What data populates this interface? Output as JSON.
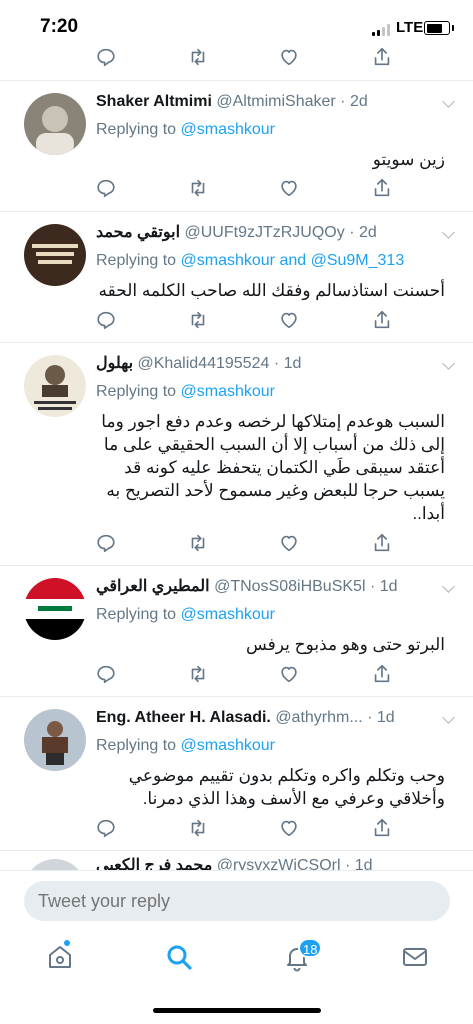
{
  "status_bar": {
    "time": "7:20",
    "network": "LTE"
  },
  "tweets": [
    {
      "name": "Shaker Altmimi",
      "handle": "@AltmimiShaker",
      "time": "2d",
      "replying_label": "Replying to",
      "replying_to": "@smashkour",
      "text": "زين سويتو"
    },
    {
      "name": "ابوتقي محمد",
      "handle": "@UUFt9zJTzRJUQOy",
      "time": "2d",
      "replying_label": "Replying to",
      "replying_to": "@smashkour and @Su9M_313",
      "text": "أحسنت استاذسالم وفقك الله صاحب الكلمه الحقه"
    },
    {
      "name": "بهلول",
      "handle": "@Khalid44195524",
      "time": "1d",
      "replying_label": "Replying to",
      "replying_to": "@smashkour",
      "text": "السبب هوعدم إمتلاكها لرخصه وعدم دفع اجور وما إلى ذلك من أسباب إلا أن السبب الحقيقي على ما أعتقد سيبقى طَي الكتمان يتحفظ عليه كونه قد يسبب حرجا للبعض وغير مسموح لأحد التصريح به أبدا.."
    },
    {
      "name": "المطيري العراقي",
      "handle": "@TNosS08iHBuSK5l",
      "time": "1d",
      "replying_label": "Replying to",
      "replying_to": "@smashkour",
      "text": "البرتو حتى وهو مذبوح يرفس"
    },
    {
      "name": "Eng. Atheer H. Alasadi.",
      "handle": "@athyrhm...",
      "time": "1d",
      "replying_label": "Replying to",
      "replying_to": "@smashkour",
      "text": "وحب وتكلم واكره وتكلم بدون تقييم موضوعي وأخلاقي وعرفي مع الأسف وهذا الذي دمرنا."
    }
  ],
  "partial_tweet": {
    "name": "محمد فرج الكعبي",
    "handle": "@rysvxzWiCSOrl",
    "time": "1d"
  },
  "compose": {
    "placeholder": "Tweet your reply"
  },
  "tabbar": {
    "notifications_badge": "18"
  },
  "colors": {
    "accent": "#1da1f2",
    "secondary": "#657786",
    "divider": "#e6ecf0"
  }
}
